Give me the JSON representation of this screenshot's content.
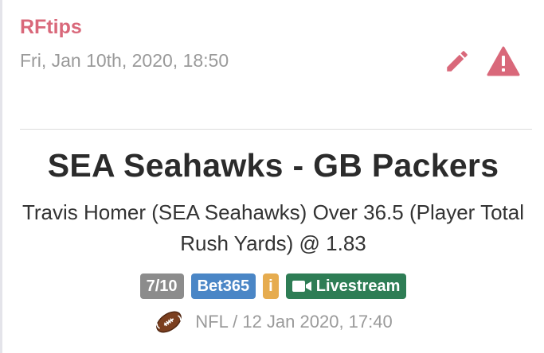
{
  "tip": {
    "author": "RFtips",
    "posted_at": "Fri, Jan 10th, 2020, 18:50",
    "match": "SEA Seahawks - GB Packers",
    "selection": "Travis Homer (SEA Seahawks) Over 36.5 (Player Total Rush Yards) @ 1.83"
  },
  "actions": {
    "edit_icon": "pencil-icon",
    "report_icon": "warning-icon"
  },
  "badges": {
    "rating": "7/10",
    "bookmaker": "Bet365",
    "info": "i",
    "livestream": "Livestream"
  },
  "event": {
    "sport_icon": "american-football-icon",
    "league_and_date": "NFL / 12 Jan 2020, 17:40"
  },
  "colors": {
    "author": "#d9687a",
    "action_icons": "#d9687a",
    "rating_badge": "#8c8c8c",
    "bookmaker_badge": "#4a86c6",
    "info_badge": "#e6ac4f",
    "livestream_badge": "#2e7d55"
  }
}
